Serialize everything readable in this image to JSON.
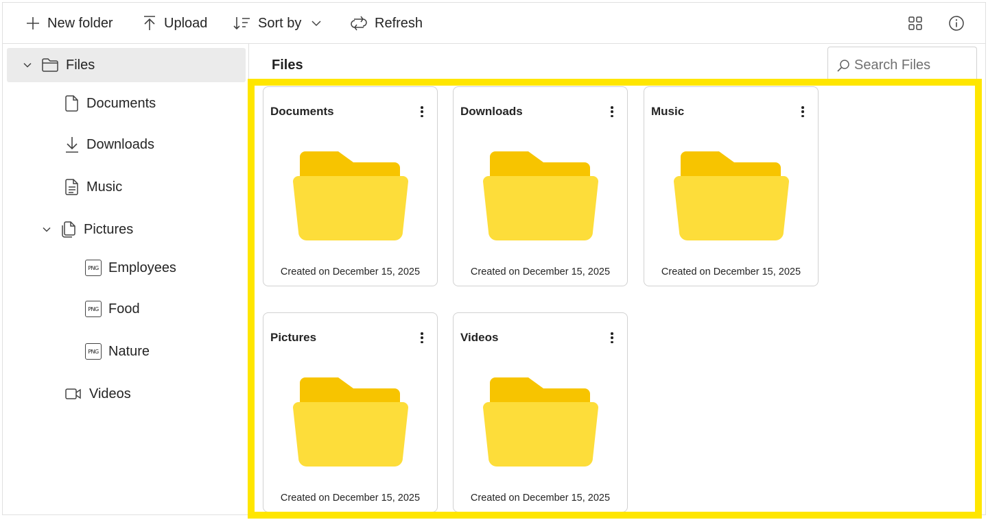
{
  "toolbar": {
    "new_folder": "New folder",
    "upload": "Upload",
    "sort_by": "Sort by",
    "refresh": "Refresh"
  },
  "sidebar": {
    "root": "Files",
    "items": [
      {
        "label": "Documents",
        "icon": "document-icon"
      },
      {
        "label": "Downloads",
        "icon": "download-icon"
      },
      {
        "label": "Music",
        "icon": "document-text-icon"
      },
      {
        "label": "Pictures",
        "icon": "documents-icon"
      },
      {
        "label": "Employees",
        "icon": "png-file-icon"
      },
      {
        "label": "Food",
        "icon": "png-file-icon"
      },
      {
        "label": "Nature",
        "icon": "png-file-icon"
      },
      {
        "label": "Videos",
        "icon": "video-icon"
      }
    ],
    "png_badge": "PNG"
  },
  "main": {
    "title": "Files",
    "search_placeholder": "Search Files",
    "cards": [
      {
        "name": "Documents",
        "date": "Created on December 15, 2025"
      },
      {
        "name": "Downloads",
        "date": "Created on December 15, 2025"
      },
      {
        "name": "Music",
        "date": "Created on December 15, 2025"
      },
      {
        "name": "Pictures",
        "date": "Created on December 15, 2025"
      },
      {
        "name": "Videos",
        "date": "Created on December 15, 2025"
      }
    ]
  },
  "colors": {
    "highlight": "#ffe600",
    "folder_back": "#f7c400",
    "folder_front": "#fddd3a",
    "selected_bg": "#ebebeb"
  }
}
